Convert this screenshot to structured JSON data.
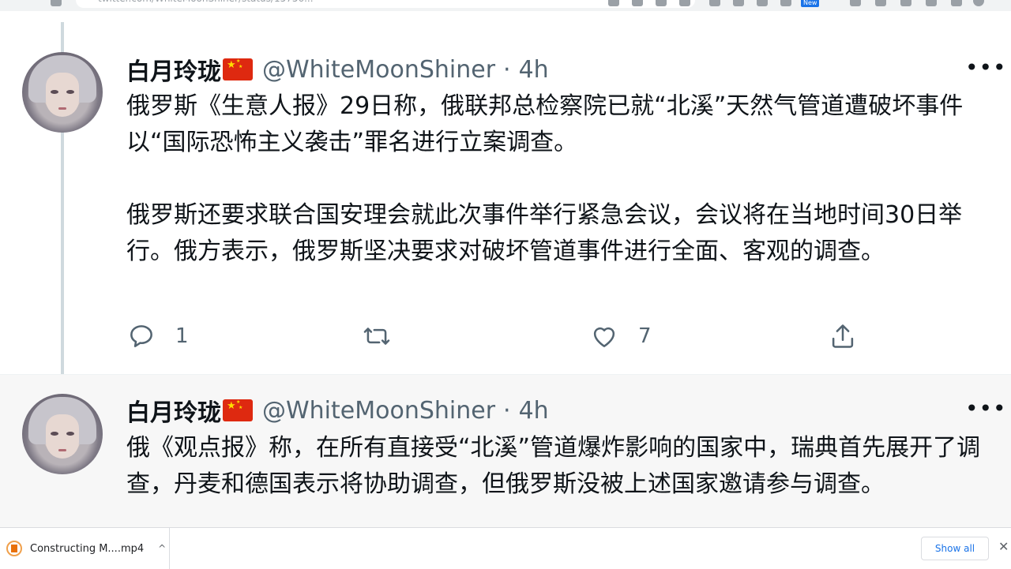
{
  "browser": {
    "url": "twitter.com/WhiteMoonShiner/status/15756...",
    "new_badge": "New"
  },
  "tweets": [
    {
      "display_name": "白月玲珑",
      "flag": "china-flag-icon",
      "handle": "@WhiteMoonShiner",
      "separator": "·",
      "time": "4h",
      "more": "•••",
      "paragraphs": [
        "俄罗斯《生意人报》29日称，俄联邦总检察院已就“北溪”天然气管道遭破坏事件以“国际恐怖主义袭击”罪名进行立案调查。",
        "俄罗斯还要求联合国安理会就此次事件举行紧急会议，会议将在当地时间30日举行。俄方表示，俄罗斯坚决要求对破坏管道事件进行全面、客观的调查。"
      ],
      "reply_count": "1",
      "retweet_count": "",
      "like_count": "7"
    },
    {
      "display_name": "白月玲珑",
      "flag": "china-flag-icon",
      "handle": "@WhiteMoonShiner",
      "separator": "·",
      "time": "4h",
      "more": "•••",
      "paragraphs": [
        "俄《观点报》称，在所有直接受“北溪”管道爆炸影响的国家中，瑞典首先展开了调查，丹麦和德国表示将协助调查，但俄罗斯没被上述国家邀请参与调查。"
      ]
    }
  ],
  "download_bar": {
    "file_name": "Constructing M....mp4",
    "chevron": "^",
    "show_all": "Show all",
    "close": "✕"
  },
  "colors": {
    "text_primary": "#0f1419",
    "text_secondary": "#536471",
    "thread_line": "#cfd9de",
    "flag_red": "#de2910",
    "link_blue": "#1a73e8"
  }
}
